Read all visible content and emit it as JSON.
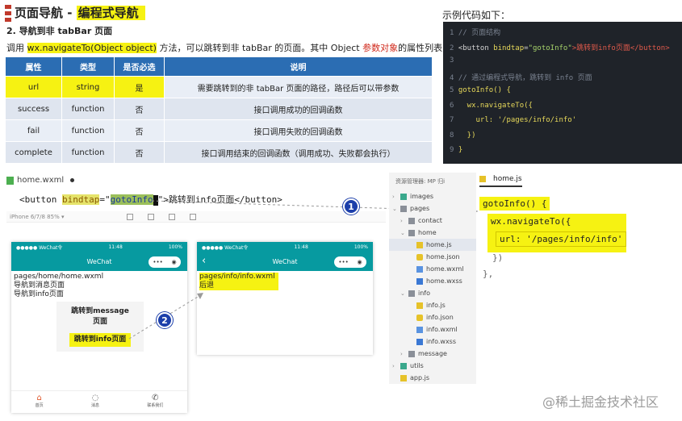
{
  "header": {
    "title_prefix": "页面导航 - ",
    "title_highlight": "编程式导航",
    "subtitle": "2. 导航到非 tabBar 页面",
    "intro_before": "调用 ",
    "intro_code": "wx.navigateTo(Object object)",
    "intro_mid": " 方法，可以跳转到非 tabBar 的页面。其中 Object ",
    "intro_red": "参数对象",
    "intro_after": "的属性列表"
  },
  "props_table": {
    "headers": [
      "属性",
      "类型",
      "是否必选",
      "说明"
    ],
    "rows": [
      {
        "name": "url",
        "type": "string",
        "required": "是",
        "desc": "需要跳转到的非 tabBar 页面的路径，路径后可以带参数"
      },
      {
        "name": "success",
        "type": "function",
        "required": "否",
        "desc": "接口调用成功的回调函数"
      },
      {
        "name": "fail",
        "type": "function",
        "required": "否",
        "desc": "接口调用失败的回调函数"
      },
      {
        "name": "complete",
        "type": "function",
        "required": "否",
        "desc": "接口调用结束的回调函数（调用成功、失败都会执行）"
      }
    ]
  },
  "sample": {
    "label": "示例代码如下：",
    "lines": [
      {
        "no": "1",
        "text": "// 页面结构"
      },
      {
        "no": "2",
        "pre": "<button ",
        "attr": "bindtap",
        "eq": "=",
        "val": "\"gotoInfo\"",
        "text2": ">跳转到info页面</button>"
      },
      {
        "no": "3",
        "text": ""
      },
      {
        "no": "4",
        "text": "// 通过编程式导航，跳转到 info 页面"
      },
      {
        "no": "5",
        "text": "gotoInfo() {"
      },
      {
        "no": "6",
        "text": "  wx.navigateTo({"
      },
      {
        "no": "7",
        "text": "    url: '/pages/info/info'"
      },
      {
        "no": "8",
        "text": "  })"
      },
      {
        "no": "9",
        "text": "}"
      }
    ]
  },
  "wxml_editor": {
    "file_name": "home.wxml",
    "code_pre": "<button ",
    "code_attr": "bindtap",
    "code_eq": "=\"",
    "code_val": "gotoInfo",
    "code_post": "\">跳转到info页面</button>"
  },
  "device_bar": {
    "device": "iPhone 6/7/8 85% ▾"
  },
  "phone_home": {
    "time": "11:48",
    "carrier": "●●●●● WeChat令",
    "battery": "100%",
    "nav_title": "WeChat",
    "lines": [
      "pages/home/home.wxml",
      "导航到消息页面",
      "导航到info页面"
    ],
    "popup_text": "跳转到message\n页面",
    "popup_button": "跳转到info页面",
    "tabs": [
      {
        "icon": "⌂",
        "label": "首页"
      },
      {
        "icon": "◌",
        "label": "消息"
      },
      {
        "icon": "✆",
        "label": "联系我们"
      }
    ]
  },
  "phone_info": {
    "time": "11:48",
    "carrier": "●●●●● WeChat令",
    "battery": "100%",
    "nav_title": "WeChat",
    "back": "‹",
    "path": "pages/info/info.wxml",
    "sub": "后退"
  },
  "file_tree": {
    "header": "资源管理器: MP 归i",
    "items": [
      {
        "depth": 1,
        "chev": "›",
        "icon": "img",
        "label": "images"
      },
      {
        "depth": 1,
        "chev": "⌄",
        "icon": "folder",
        "label": "pages"
      },
      {
        "depth": 2,
        "chev": "›",
        "icon": "folder",
        "label": "contact"
      },
      {
        "depth": 2,
        "chev": "⌄",
        "icon": "folder",
        "label": "home"
      },
      {
        "depth": 3,
        "chev": "",
        "icon": "js",
        "label": "home.js",
        "selected": true
      },
      {
        "depth": 3,
        "chev": "",
        "icon": "json",
        "label": "home.json"
      },
      {
        "depth": 3,
        "chev": "",
        "icon": "wxml",
        "label": "home.wxml"
      },
      {
        "depth": 3,
        "chev": "",
        "icon": "wxss",
        "label": "home.wxss"
      },
      {
        "depth": 2,
        "chev": "⌄",
        "icon": "folder",
        "label": "info"
      },
      {
        "depth": 3,
        "chev": "",
        "icon": "js",
        "label": "info.js"
      },
      {
        "depth": 3,
        "chev": "",
        "icon": "json",
        "label": "info.json"
      },
      {
        "depth": 3,
        "chev": "",
        "icon": "wxml",
        "label": "info.wxml"
      },
      {
        "depth": 3,
        "chev": "",
        "icon": "wxss",
        "label": "info.wxss"
      },
      {
        "depth": 2,
        "chev": "›",
        "icon": "folder",
        "label": "message"
      },
      {
        "depth": 1,
        "chev": "›",
        "icon": "img",
        "label": "utils"
      },
      {
        "depth": 1,
        "chev": "",
        "icon": "js",
        "label": "app.js"
      }
    ]
  },
  "js_editor": {
    "file_name": "home.js",
    "fn": "gotoInfo() {",
    "call": "wx.navigateTo({",
    "url_line": "url: '/pages/info/info'",
    "close1": "})",
    "close2": "},"
  },
  "badges": {
    "one": "1",
    "two": "2"
  },
  "watermark": "@稀土掘金技术社区"
}
